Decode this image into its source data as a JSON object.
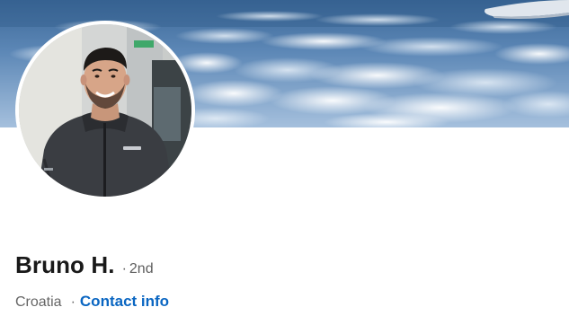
{
  "profile": {
    "name": "Bruno H.",
    "degree_separator": "·",
    "connection_degree": "2nd",
    "location": "Croatia",
    "location_separator": "·",
    "contact_info_label": "Contact info"
  },
  "banner": {
    "image": "sky-above-clouds-from-airplane-window"
  },
  "avatar": {
    "image": "man-smiling-in-dark-softshell-jacket"
  },
  "colors": {
    "name_text": "#191919",
    "secondary_text": "#666666",
    "link": "#0a66c2",
    "background": "#ffffff"
  }
}
